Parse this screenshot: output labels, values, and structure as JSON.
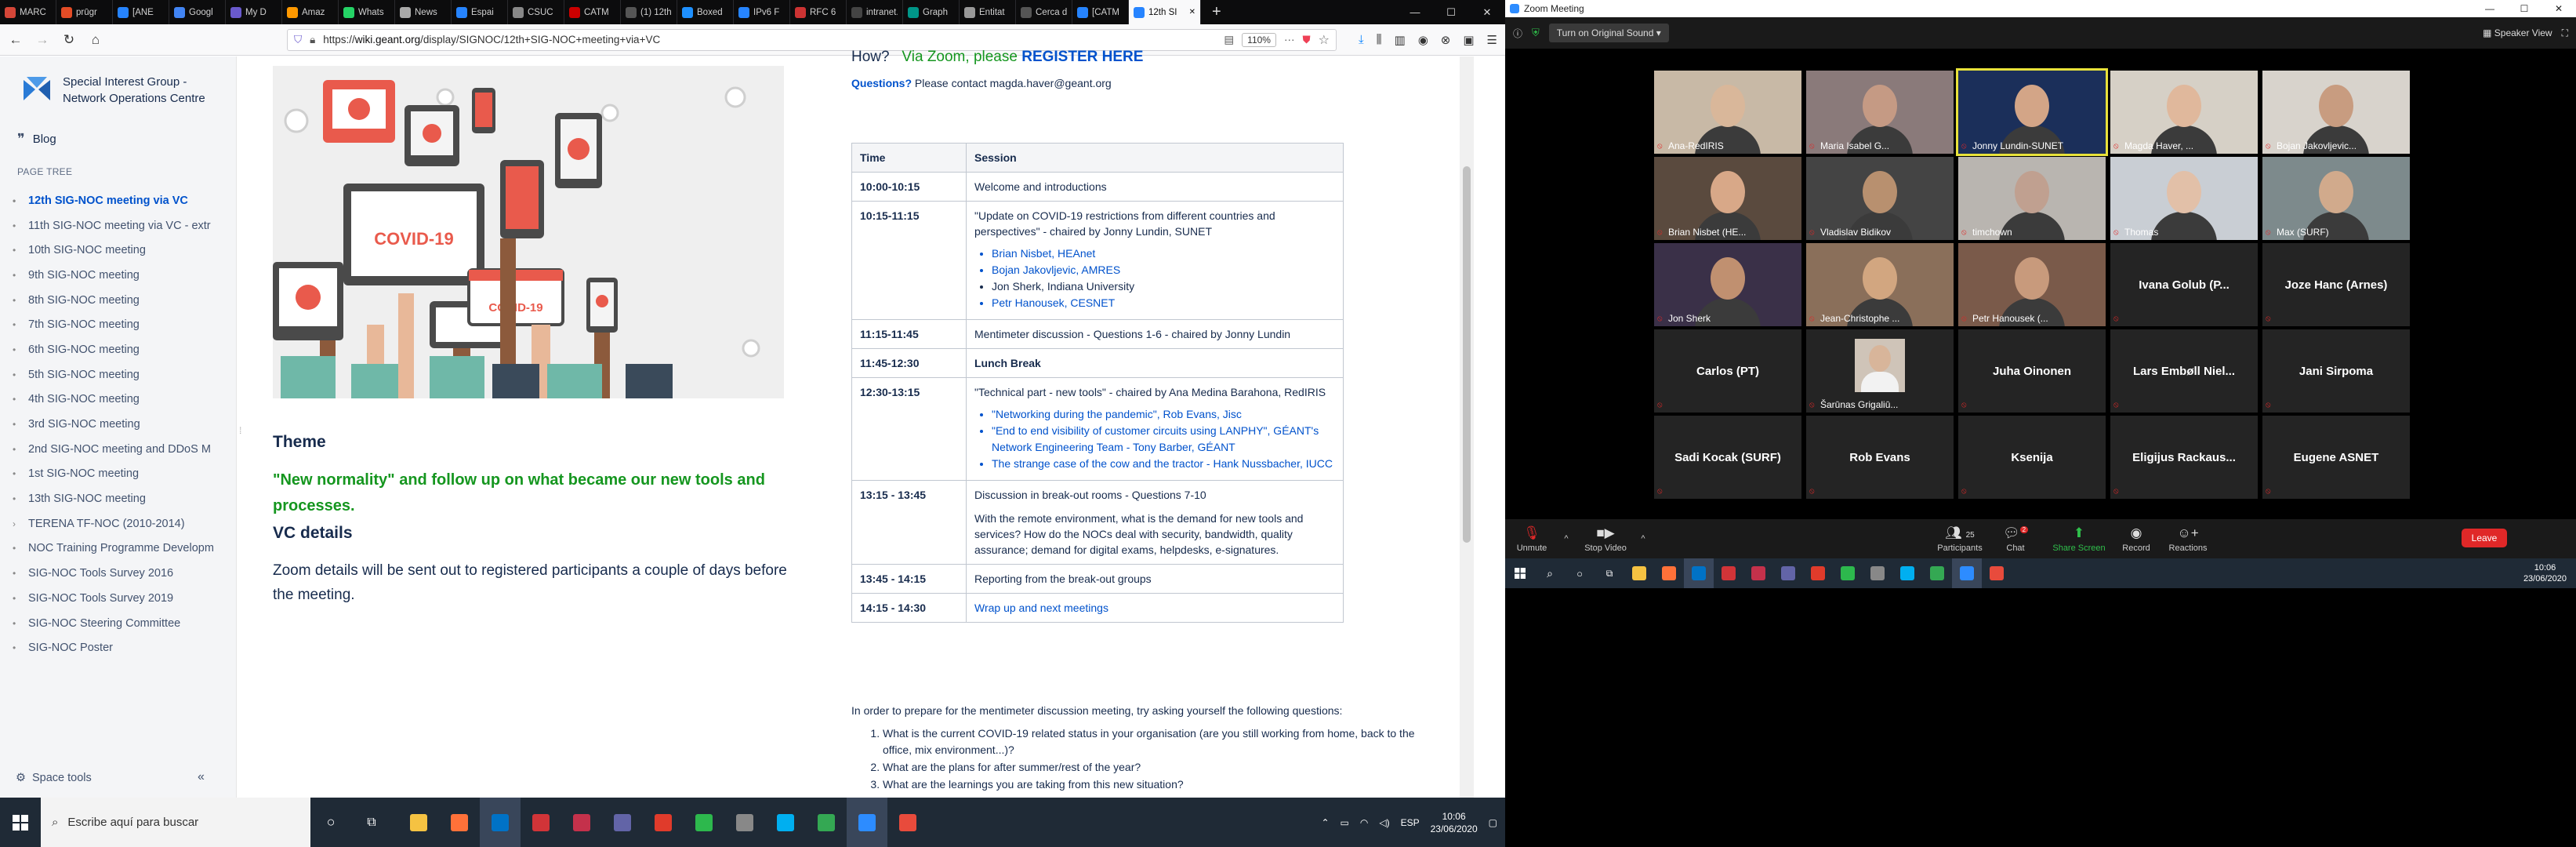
{
  "browser": {
    "tabs": [
      {
        "label": "MARC",
        "color": "#d44638"
      },
      {
        "label": "prūgr",
        "color": "#e34c26"
      },
      {
        "label": "[ANE",
        "color": "#2684ff"
      },
      {
        "label": "Googl",
        "color": "#4285f4"
      },
      {
        "label": "My D",
        "color": "#6a5acd"
      },
      {
        "label": "Amaz",
        "color": "#ff9900"
      },
      {
        "label": "Whats",
        "color": "#25d366"
      },
      {
        "label": "News",
        "color": "#aaaaaa"
      },
      {
        "label": "Espai",
        "color": "#2684ff"
      },
      {
        "label": "CSUC",
        "color": "#888888"
      },
      {
        "label": "CATM",
        "color": "#cc0000"
      },
      {
        "label": "(1) 12th SI",
        "color": "#555555"
      },
      {
        "label": "Boxed",
        "color": "#1e90ff"
      },
      {
        "label": "IPv6 F",
        "color": "#2684ff"
      },
      {
        "label": "RFC 6",
        "color": "#cc3333"
      },
      {
        "label": "intranet.gr",
        "color": "#444444"
      },
      {
        "label": "Graph",
        "color": "#009688"
      },
      {
        "label": "Entitat",
        "color": "#999999"
      },
      {
        "label": "Cerca de",
        "color": "#555555"
      },
      {
        "label": "[CATM",
        "color": "#2684ff"
      },
      {
        "label": "12th SI",
        "color": "#2684ff",
        "active": true
      }
    ],
    "url_prefix": "https://",
    "url_domain": "wiki.geant.org",
    "url_path": "/display/SIGNOC/12th+SIG-NOC+meeting+via+VC",
    "zoom": "110%"
  },
  "wiki": {
    "space_name": "Special Interest Group - Network Operations Centre",
    "blog_label": "Blog",
    "page_tree_label": "PAGE TREE",
    "tree": [
      {
        "label": "12th SIG-NOC meeting via VC",
        "current": true
      },
      {
        "label": "11th SIG-NOC meeting via VC - extr"
      },
      {
        "label": "10th SIG-NOC meeting"
      },
      {
        "label": "9th SIG-NOC meeting"
      },
      {
        "label": "8th SIG-NOC meeting"
      },
      {
        "label": "7th SIG-NOC meeting"
      },
      {
        "label": "6th SIG-NOC meeting"
      },
      {
        "label": "5th SIG-NOC meeting"
      },
      {
        "label": "4th SIG-NOC meeting"
      },
      {
        "label": "3rd SIG-NOC meeting"
      },
      {
        "label": "2nd SIG-NOC meeting and DDoS M"
      },
      {
        "label": "1st SIG-NOC meeting"
      },
      {
        "label": "13th SIG-NOC meeting"
      },
      {
        "label": "TERENA TF-NOC (2010-2014)",
        "expand": true
      },
      {
        "label": "NOC Training Programme Developm"
      },
      {
        "label": "SIG-NOC Tools Survey 2016"
      },
      {
        "label": "SIG-NOC Tools Survey 2019"
      },
      {
        "label": "SIG-NOC Steering Committee"
      },
      {
        "label": "SIG-NOC Poster"
      }
    ],
    "space_tools": "Space tools",
    "illus_labels": [
      "COVID-19",
      "COVID-19"
    ],
    "theme_heading": "Theme",
    "theme_text": "\"New normality\" and follow up on what became our new tools and processes.",
    "vc_heading": "VC details",
    "vc_text": "Zoom details will be sent out to registered participants a couple of days before the meeting.",
    "how_prefix": "How?",
    "how_mid": "Via Zoom, please",
    "how_link": "REGISTER HERE",
    "questions_label": "Questions?",
    "questions_text": "Please contact magda.haver@geant.org",
    "table_headers": [
      "Time",
      "Session"
    ],
    "schedule": [
      {
        "time": "10:00-10:15",
        "text": "Welcome and introductions"
      },
      {
        "time": "10:15-11:15",
        "text": "\"Update on COVID-19 restrictions from different countries and perspectives\" - chaired by Jonny Lundin, SUNET",
        "items": [
          {
            "text": "Brian Nisbet, HEAnet",
            "link": true
          },
          {
            "text": "Bojan Jakovljevic, AMRES",
            "link": true
          },
          {
            "text": "Jon Sherk, Indiana University",
            "link": false
          },
          {
            "text": "Petr Hanousek, CESNET",
            "link": true
          }
        ]
      },
      {
        "time": "11:15-11:45",
        "text": "Mentimeter discussion - Questions 1-6 - chaired by Jonny Lundin"
      },
      {
        "time": "11:45-12:30",
        "text": "Lunch Break",
        "bold": true
      },
      {
        "time": "12:30-13:15",
        "text": "\"Technical part - new tools\" - chaired by Ana Medina Barahona, RedIRIS",
        "items": [
          {
            "text": "\"Networking during the pandemic\", Rob Evans, Jisc",
            "link": true
          },
          {
            "text": "\"End to end visibility of customer circuits using LANPHY\", GÉANT's Network Engineering Team - Tony Barber, GÉANT",
            "link": true
          },
          {
            "text": "The strange case of the cow and the tractor - Hank Nussbacher, IUCC",
            "link": true
          }
        ]
      },
      {
        "time": "13:15 - 13:45",
        "text": "Discussion in break-out rooms - Questions 7-10",
        "extra": "With the remote environment, what is the demand for new tools and services? How do the NOCs deal with security, bandwidth, quality assurance; demand for digital exams, helpdesks, e-signatures."
      },
      {
        "time": "13:45 - 14:15",
        "text": "Reporting from the break-out groups"
      },
      {
        "time": "14:15 - 14:30",
        "text": "Wrap up and next meetings"
      }
    ],
    "prep_text": "In order to prepare for the mentimeter discussion meeting, try asking yourself the following questions:",
    "questions": [
      "What is the current COVID-19 related status in your organisation (are you still working from home, back to the office, mix environment...)?",
      "What are the plans for after summer/rest of the year?",
      "What are the learnings you are taking from this new situation?"
    ]
  },
  "taskbar_left": {
    "search_placeholder": "Escribe aquí para buscar",
    "lang": "ESP",
    "time": "10:06",
    "date": "23/06/2020",
    "apps": [
      {
        "color": "#f5c242"
      },
      {
        "color": "#ff7139"
      },
      {
        "color": "#0072c6",
        "active": true
      },
      {
        "color": "#d13438"
      },
      {
        "color": "#c4314b"
      },
      {
        "color": "#6264a7"
      },
      {
        "color": "#e03b2b"
      },
      {
        "color": "#2db84d"
      },
      {
        "color": "#888888"
      },
      {
        "color": "#00aff0"
      },
      {
        "color": "#34a853"
      },
      {
        "color": "#2d8cff",
        "active": true
      },
      {
        "color": "#e84b3c"
      }
    ]
  },
  "zoom": {
    "title": "Zoom Meeting",
    "sound_btn": "Turn on Original Sound",
    "speaker_view": "Speaker View",
    "participants": [
      {
        "name": "Ana-RedIRIS",
        "video": true,
        "bg": "#c8b9a6",
        "face": "#d9b79a"
      },
      {
        "name": "Maria Isabel G...",
        "video": true,
        "bg": "#8a7a7a",
        "face": "#c59a84"
      },
      {
        "name": "Jonny Lundin-SUNET",
        "video": true,
        "bg": "#1b2f5a",
        "face": "#d3a587",
        "speaking": true
      },
      {
        "name": "Magda Haver, ...",
        "video": true,
        "bg": "#d6d0c6",
        "face": "#e0b89c"
      },
      {
        "name": "Bojan Jakovljevic...",
        "video": true,
        "bg": "#d8d3cc",
        "face": "#c89c80"
      },
      {
        "name": "Brian Nisbet (HE...",
        "video": true,
        "bg": "#5a4a3e",
        "face": "#d8a888"
      },
      {
        "name": "Vladislav Bidikov",
        "video": true,
        "bg": "#444444",
        "face": "#b8906f"
      },
      {
        "name": "timchown",
        "video": true,
        "bg": "#b9b5b0",
        "face": "#c0a090"
      },
      {
        "name": "Thomas",
        "video": true,
        "bg": "#c9ced4",
        "face": "#e2c0a8"
      },
      {
        "name": "Max (SURF)",
        "video": true,
        "bg": "#7d8a8c",
        "face": "#d1aa8c"
      },
      {
        "name": "Jon Sherk",
        "video": true,
        "bg": "#3a3048",
        "face": "#c09070"
      },
      {
        "name": "Jean-Christophe ...",
        "video": true,
        "bg": "#8a6f5a",
        "face": "#d2a680"
      },
      {
        "name": "Petr Hanousek (...",
        "video": true,
        "bg": "#7a5a4a",
        "face": "#c89a7c"
      },
      {
        "name": "Ivana Golub (P...",
        "video": false
      },
      {
        "name": "Joze Hanc (Arnes)",
        "video": false
      },
      {
        "name": "Carlos (PT)",
        "video": false
      },
      {
        "name": "Šarūnas Grigaliū...",
        "video": false,
        "photo": true
      },
      {
        "name": "Juha Oinonen",
        "video": false
      },
      {
        "name": "Lars  Embøll  Niel...",
        "video": false
      },
      {
        "name": "Jani Sirpoma",
        "video": false
      },
      {
        "name": "Sadi Kocak (SURF)",
        "video": false
      },
      {
        "name": "Rob Evans",
        "video": false
      },
      {
        "name": "Ksenija",
        "video": false
      },
      {
        "name": "Eligijus  Rackaus...",
        "video": false
      },
      {
        "name": "Eugene ASNET",
        "video": false
      }
    ],
    "controls": {
      "unmute": "Unmute",
      "stop_video": "Stop Video",
      "participants": "Participants",
      "participant_count": "25",
      "chat": "Chat",
      "chat_badge": "2",
      "share_screen": "Share Screen",
      "record": "Record",
      "reactions": "Reactions",
      "leave": "Leave"
    },
    "time": "10:06",
    "date": "23/06/2020",
    "task_apps": [
      {
        "color": "#f5c242"
      },
      {
        "color": "#ff7139"
      },
      {
        "color": "#0072c6",
        "active": true
      },
      {
        "color": "#d13438"
      },
      {
        "color": "#c4314b"
      },
      {
        "color": "#6264a7"
      },
      {
        "color": "#e03b2b"
      },
      {
        "color": "#2db84d"
      },
      {
        "color": "#888888"
      },
      {
        "color": "#00aff0"
      },
      {
        "color": "#34a853"
      },
      {
        "color": "#2d8cff",
        "active": true
      },
      {
        "color": "#e84b3c"
      }
    ]
  }
}
